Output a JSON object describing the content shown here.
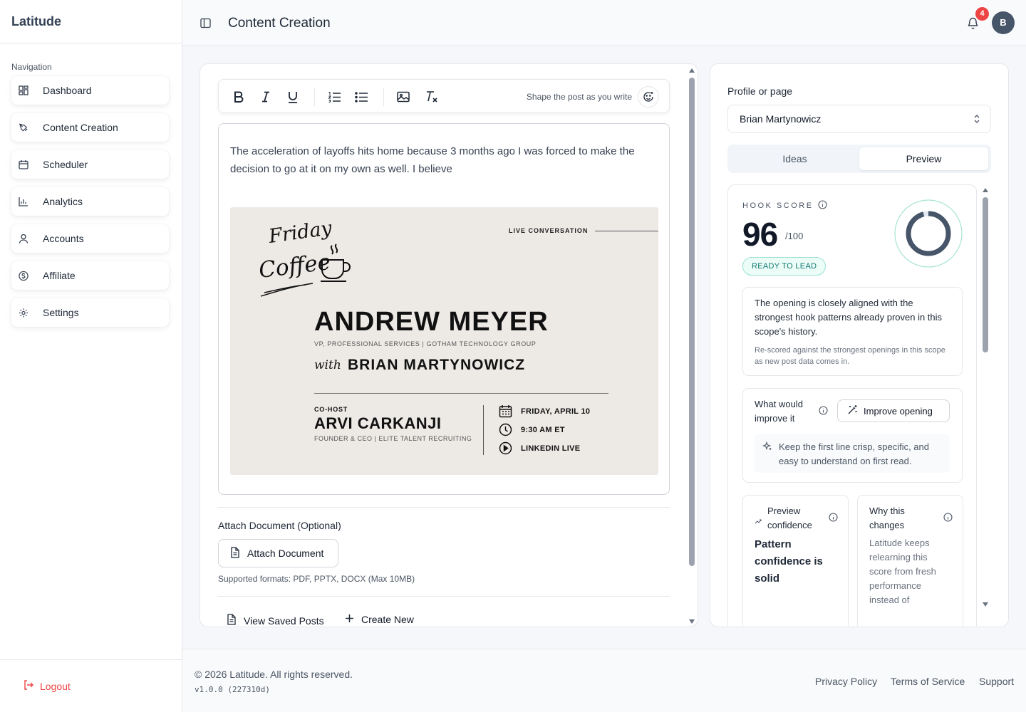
{
  "app": {
    "brand": "Latitude"
  },
  "sidebar": {
    "heading": "Navigation",
    "items": [
      {
        "label": "Dashboard",
        "icon": "dashboard-icon"
      },
      {
        "label": "Content Creation",
        "icon": "pen-tool-icon"
      },
      {
        "label": "Scheduler",
        "icon": "calendar-icon"
      },
      {
        "label": "Analytics",
        "icon": "bar-chart-icon"
      },
      {
        "label": "Accounts",
        "icon": "user-icon"
      },
      {
        "label": "Affiliate",
        "icon": "dollar-icon"
      },
      {
        "label": "Settings",
        "icon": "gear-icon"
      }
    ],
    "logout": "Logout"
  },
  "header": {
    "title": "Content Creation",
    "notification_count": "4",
    "avatar_initial": "B"
  },
  "editor": {
    "toolbar_hint": "Shape the post as you write",
    "text": "The acceleration of layoffs hits home because 3 months ago I was forced to make the decision to go at it on my own as well.  I believe",
    "image": {
      "script_line1": "Friday",
      "script_line2": "Coffee",
      "tag": "LIVE CONVERSATION",
      "guest_name": "ANDREW MEYER",
      "guest_role": "VP, PROFESSIONAL SERVICES  |  GOTHAM TECHNOLOGY GROUP",
      "with_word": "with",
      "host_name": "BRIAN MARTYNOWICZ",
      "cohost_label": "CO-HOST",
      "cohost_name": "ARVI CARKANJI",
      "cohost_role": "FOUNDER & CEO  |  ELITE TALENT RECRUITING",
      "date": "FRIDAY, APRIL 10",
      "time": "9:30 AM ET",
      "platform": "LINKEDIN LIVE"
    },
    "attach_title": "Attach Document (Optional)",
    "attach_button": "Attach Document",
    "formats": "Supported formats: PDF, PPTX, DOCX (Max 10MB)",
    "view_saved": "View Saved Posts",
    "create_new": "Create New"
  },
  "panel": {
    "profile_label": "Profile or page",
    "profile_value": "Brian Martynowicz",
    "tabs": [
      "Ideas",
      "Preview"
    ],
    "active_tab": "Preview",
    "hook_label": "HOOK SCORE",
    "score": "96",
    "score_max": "/100",
    "score_fraction": 0.96,
    "status": "READY TO LEAD",
    "summary": "The opening is closely aligned with the strongest hook patterns already proven in this scope's history.",
    "summary_note": "Re-scored against the strongest openings in this scope as new post data comes in.",
    "improve_title": "What would improve it",
    "improve_button": "Improve opening",
    "tip": "Keep the first line crisp, specific, and easy to understand on first read.",
    "confidence_title": "Preview confidence",
    "confidence_value": "Pattern confidence is solid",
    "why_title": "Why this changes",
    "why_body": "Latitude keeps relearning this score from fresh performance instead of"
  },
  "footer": {
    "copyright": "© 2026 Latitude. All rights reserved.",
    "version": "v1.0.0 (227310d)",
    "links": [
      "Privacy Policy",
      "Terms of Service",
      "Support"
    ]
  },
  "colors": {
    "accent": "#475569",
    "danger": "#ef4444",
    "ready": "#0f766e"
  }
}
